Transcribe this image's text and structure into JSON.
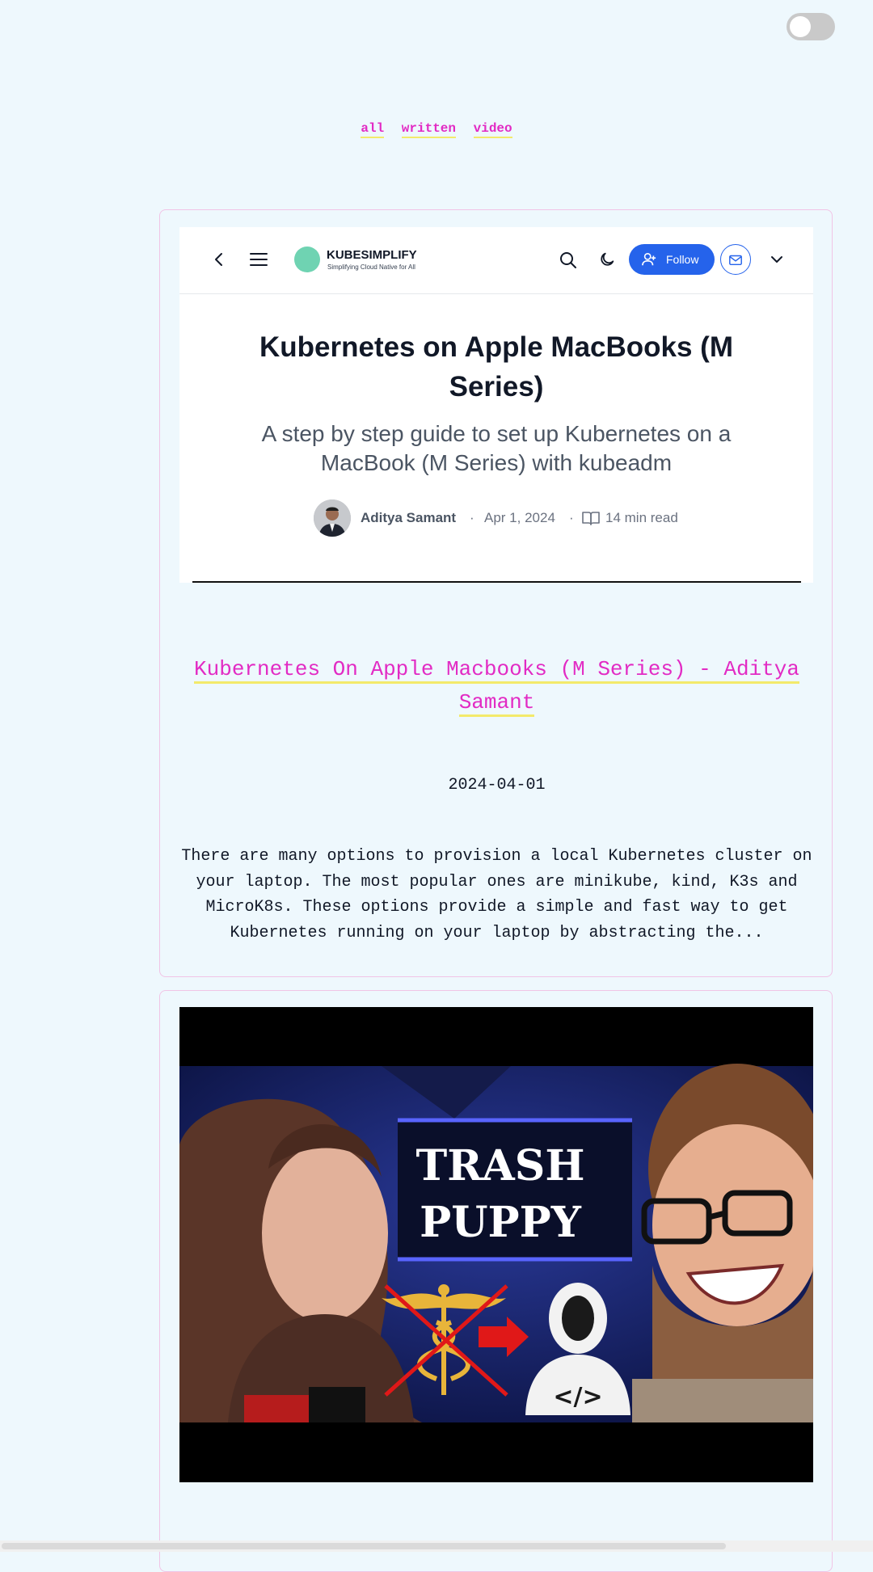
{
  "header": {
    "filters": [
      {
        "label": "all"
      },
      {
        "label": "written"
      },
      {
        "label": "video"
      }
    ]
  },
  "card_written": {
    "embedded": {
      "brand_name": "KUBESIMPLIFY",
      "brand_tagline": "Simplifying Cloud Native for All",
      "follow_label": "Follow",
      "title": "Kubernetes on Apple MacBooks (M Series)",
      "subtitle": "A step by step guide to set up Kubernetes on a MacBook (M Series) with kubeadm",
      "author": "Aditya Samant",
      "date": "Apr 1, 2024",
      "read_time": "14 min read",
      "separator": "·"
    },
    "link_text": "Kubernetes On Apple Macbooks (M Series) - Aditya Samant",
    "date": "2024-04-01",
    "excerpt": "There are many options to provision a local Kubernetes cluster on your laptop. The most popular ones are minikube, kind, K3s and MicroK8s. These options provide a simple and fast way to get Kubernetes running on your laptop by abstracting the..."
  },
  "card_video": {
    "thumbnail_text_line1": "TRASH",
    "thumbnail_text_line2": "PUPPY",
    "thumbnail_code": "</>"
  },
  "colors": {
    "background": "#eef8fd",
    "link": "#e22bc4",
    "underline": "#f3ea6b",
    "card_border": "#f1c4e6",
    "follow_button": "#2563eb"
  }
}
